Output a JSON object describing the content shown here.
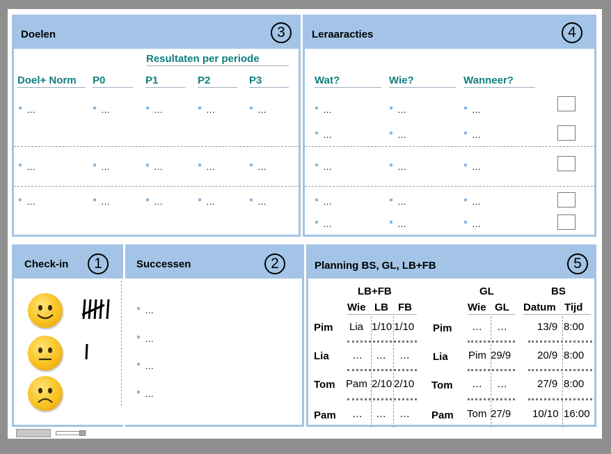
{
  "panels": {
    "doelen": {
      "title": "Doelen",
      "num": "3",
      "group_header": "Resultaten per periode",
      "columns": [
        "Doel+ Norm",
        "P0",
        "P1",
        "P2",
        "P3"
      ],
      "ellipsis": "…"
    },
    "leraaracties": {
      "title": "Leraaracties",
      "num": "4",
      "columns": [
        "Wat?",
        "Wie?",
        "Wanneer?"
      ],
      "ellipsis": "…"
    },
    "checkin": {
      "title": "Check-in",
      "num": "1",
      "moods": [
        {
          "icon": "happy-smiley-icon",
          "tally": 6
        },
        {
          "icon": "neutral-smiley-icon",
          "tally": 1
        },
        {
          "icon": "sad-smiley-icon",
          "tally": 0
        }
      ]
    },
    "successen": {
      "title": "Successen",
      "num": "2",
      "ellipsis": "…"
    },
    "planning": {
      "title": "Planning BS, GL, LB+FB",
      "num": "5",
      "groups": {
        "lbfb": "LB+FB",
        "gl": "GL",
        "bs": "BS"
      },
      "columns": {
        "lbfb_wie": "Wie",
        "lb": "LB",
        "fb": "FB",
        "gl_wie": "Wie",
        "gl": "GL",
        "datum": "Datum",
        "tijd": "Tijd"
      },
      "rows": [
        {
          "name": "Pim",
          "lbfb_wie": "Lia",
          "lb": "1/10",
          "fb": "1/10",
          "name2": "Pim",
          "gl_wie": "…",
          "gl": "…",
          "datum": "13/9",
          "tijd": "8:00"
        },
        {
          "name": "Lia",
          "lbfb_wie": "…",
          "lb": "…",
          "fb": "…",
          "name2": "Lia",
          "gl_wie": "Pim",
          "gl": "29/9",
          "datum": "20/9",
          "tijd": "8:00"
        },
        {
          "name": "Tom",
          "lbfb_wie": "Pam",
          "lb": "2/10",
          "fb": "2/10",
          "name2": "Tom",
          "gl_wie": "…",
          "gl": "…",
          "datum": "27/9",
          "tijd": "8:00"
        },
        {
          "name": "Pam",
          "lbfb_wie": "…",
          "lb": "…",
          "fb": "…",
          "name2": "Pam",
          "gl_wie": "Tom",
          "gl": "27/9",
          "datum": "10/10",
          "tijd": "16:00"
        }
      ]
    }
  },
  "colors": {
    "header": "#a3c4e6",
    "teal": "#0f7f7f",
    "background": "#8f8f8f"
  }
}
